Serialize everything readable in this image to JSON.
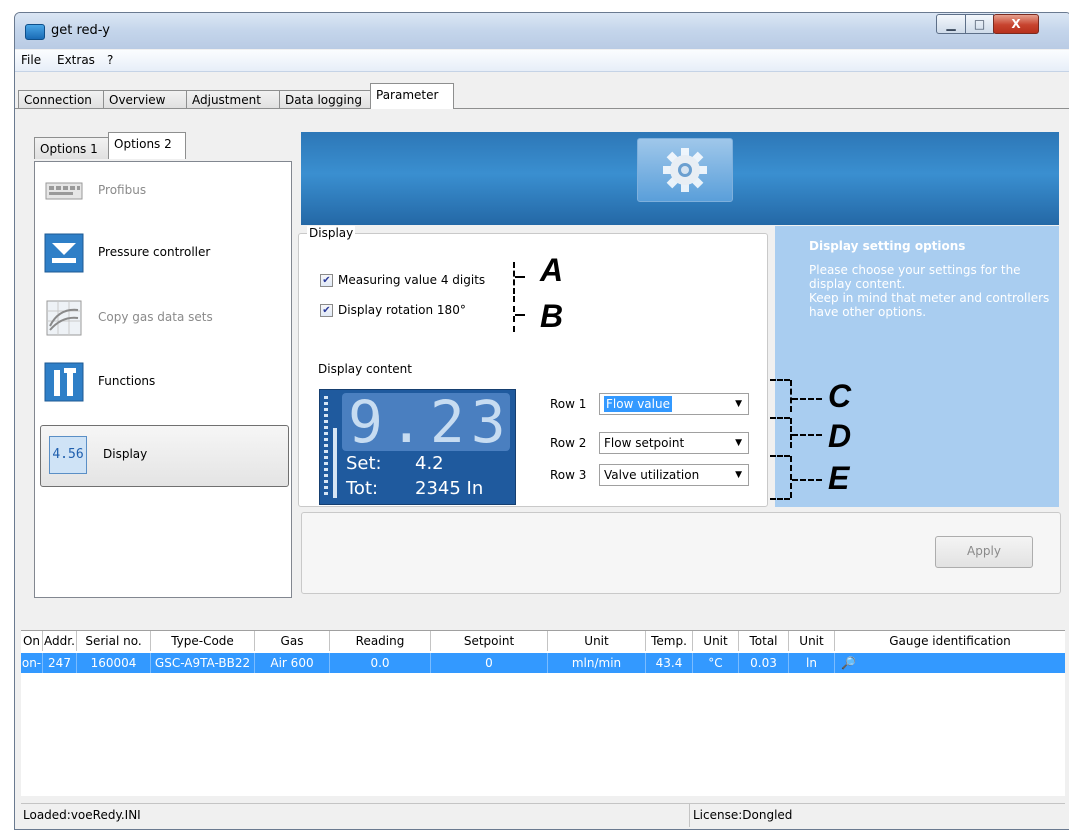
{
  "window": {
    "title": "get red-y",
    "min_symbol": "▁",
    "max_symbol": "□",
    "close_symbol": "X"
  },
  "menu": [
    "File",
    "Extras",
    "?"
  ],
  "tabs": [
    "Connection",
    "Overview",
    "Adjustment",
    "Data logging",
    "Parameter"
  ],
  "subtabs": [
    "Options 1",
    "Options 2"
  ],
  "left_items": [
    {
      "label": "Profibus",
      "icon": "profibus-icon",
      "disabled": true
    },
    {
      "label": "Pressure controller",
      "icon": "pressure-controller-icon",
      "disabled": false
    },
    {
      "label": "Copy gas data sets",
      "icon": "copy-gas-data-icon",
      "disabled": true
    },
    {
      "label": "Functions",
      "icon": "functions-icon",
      "disabled": false
    },
    {
      "label": "Display",
      "icon": "display-icon",
      "icon_text": "4.56",
      "disabled": false,
      "selected": true
    }
  ],
  "display": {
    "legend": "Display",
    "measuring_value": {
      "label": "Measuring value 4 digits",
      "checked": true
    },
    "rotation": {
      "label": "Display rotation 180°",
      "checked": true
    },
    "content_label": "Display content",
    "lcd": {
      "big": "9.23",
      "set_label": "Set:",
      "set_value": "4.2",
      "tot_label": "Tot:",
      "tot_value": "2345 In"
    },
    "rows": [
      {
        "label": "Row 1",
        "value": "Flow value"
      },
      {
        "label": "Row 2",
        "value": "Flow setpoint"
      },
      {
        "label": "Row 3",
        "value": "Valve utilization"
      }
    ]
  },
  "help": {
    "title": "Display setting options",
    "line1": "Please choose your settings for the display content.",
    "line2": "Keep in mind that meter and controllers have other options."
  },
  "apply_label": "Apply",
  "grid": {
    "headers": [
      "On",
      "Addr.",
      "Serial no.",
      "Type-Code",
      "Gas",
      "Reading",
      "Setpoint",
      "Unit",
      "Temp.",
      "Unit",
      "Total",
      "Unit",
      "Gauge identification"
    ],
    "row": [
      "on-",
      "247",
      "160004",
      "GSC-A9TA-BB22",
      "Air 600",
      "0.0",
      "0",
      "mln/min",
      "43.4",
      "°C",
      "0.03",
      "ln",
      ""
    ]
  },
  "status": {
    "left": "Loaded:voeRedy.INI",
    "right": "License:Dongled"
  },
  "annotations": [
    "A",
    "B",
    "C",
    "D",
    "E"
  ],
  "colors": {
    "accent": "#3399ff",
    "banner": "#2d77b7",
    "help_bg": "#a9cdf0",
    "lcd_bg": "#1f5a9e"
  }
}
